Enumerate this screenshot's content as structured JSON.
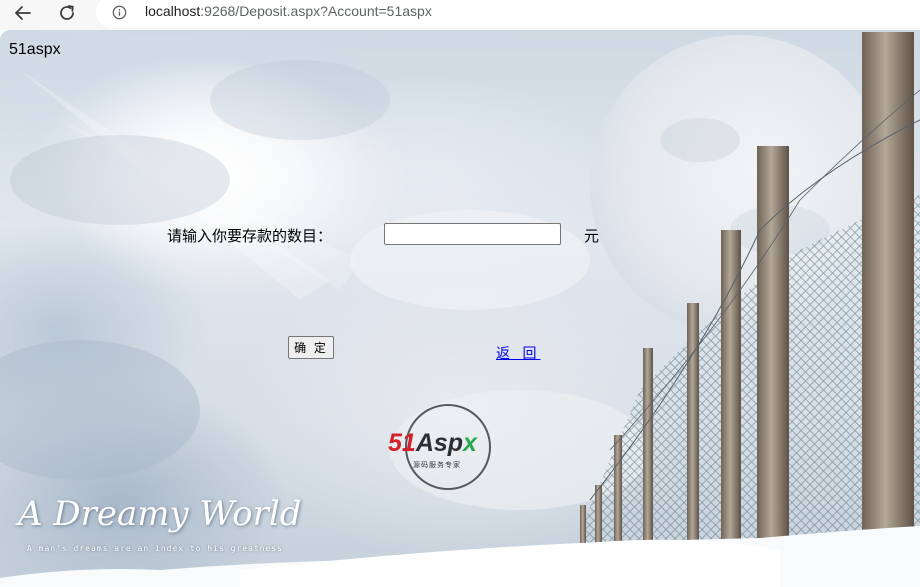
{
  "browser": {
    "url_host": "localhost",
    "url_rest": ":9268/Deposit.aspx?Account=51aspx",
    "back_icon": "back-arrow-icon",
    "reload_icon": "reload-icon",
    "info_icon": "info-icon"
  },
  "page": {
    "site_name": "51aspx",
    "deposit_label": "请输入你要存款的数目：",
    "amount_value": "",
    "unit_label": "元",
    "confirm_label": "确 定",
    "return_label": "返 回"
  },
  "logo": {
    "brand_51": "51",
    "brand_asp": "Asp",
    "brand_x": "x",
    "tagline": "源码服务专家"
  },
  "banner": {
    "title": "A Dreamy World",
    "subtitle": "A man's dreams are an index to his greatness"
  }
}
